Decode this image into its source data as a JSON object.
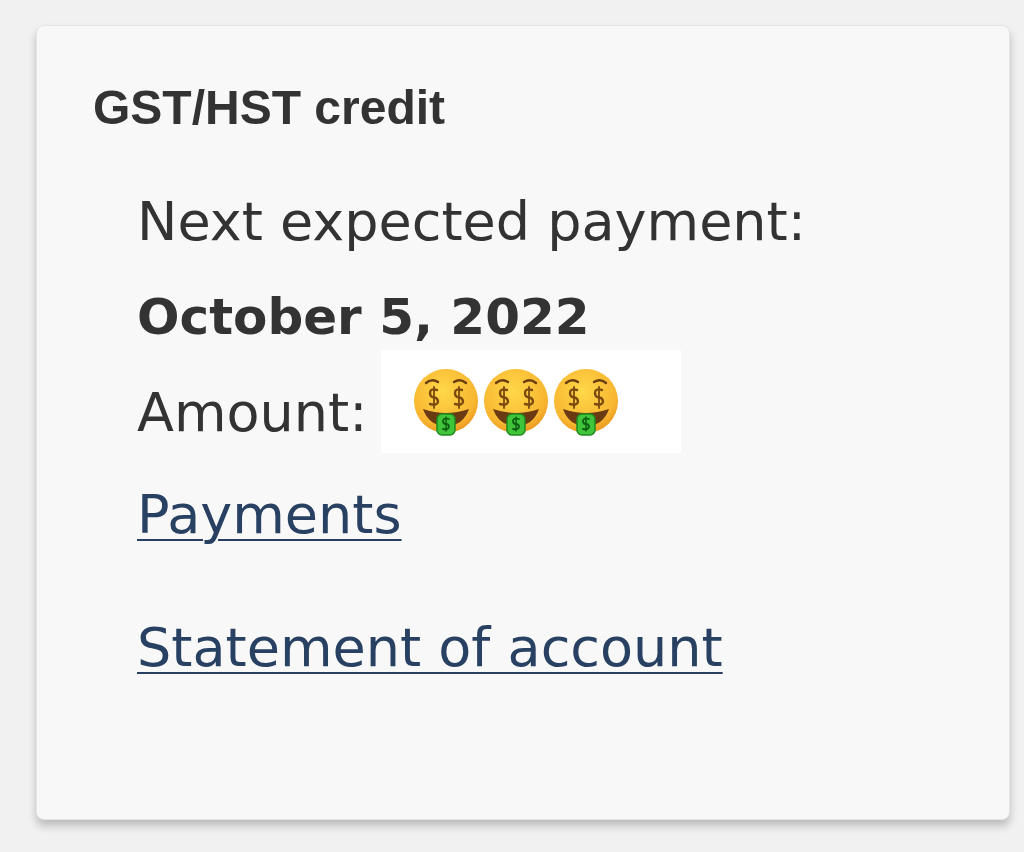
{
  "card": {
    "title": "GST/HST credit",
    "next_payment": {
      "label": "Next expected payment:",
      "date": "October 5, 2022"
    },
    "amount": {
      "label": "Amount:"
    },
    "links": [
      "Payments",
      "Statement of account"
    ]
  }
}
